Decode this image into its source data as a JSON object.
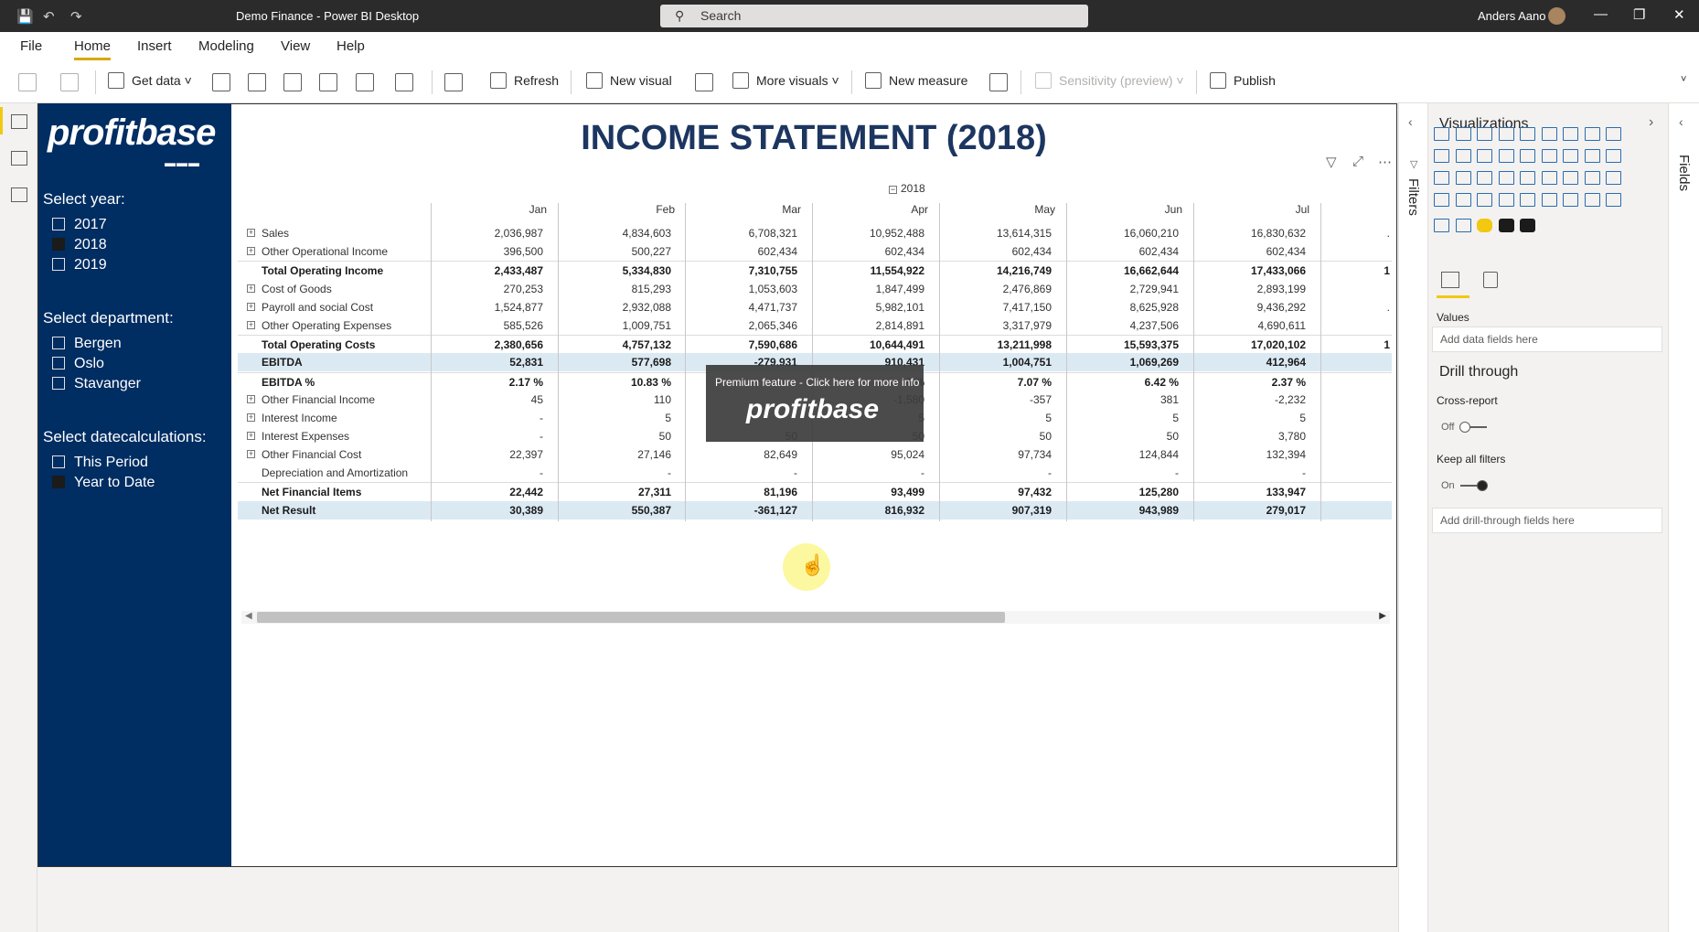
{
  "window": {
    "title": "Demo Finance - Power BI Desktop",
    "search_placeholder": "Search",
    "user": "Anders Aano"
  },
  "menu": {
    "items": [
      "File",
      "Home",
      "Insert",
      "Modeling",
      "View",
      "Help"
    ],
    "active": "Home"
  },
  "ribbon": {
    "get_data": "Get data",
    "refresh": "Refresh",
    "new_visual": "New visual",
    "more_visuals": "More visuals",
    "new_measure": "New measure",
    "sensitivity": "Sensitivity (preview)",
    "publish": "Publish"
  },
  "slicers": {
    "logo": "profitbase",
    "year": {
      "title": "Select year:",
      "options": [
        "2017",
        "2018",
        "2019"
      ],
      "selected": "2018"
    },
    "department": {
      "title": "Select department:",
      "options": [
        "Bergen",
        "Oslo",
        "Stavanger"
      ]
    },
    "datecalc": {
      "title": "Select datecalculations:",
      "options": [
        "This Period",
        "Year to Date"
      ],
      "selected": "Year to Date"
    }
  },
  "report": {
    "title": "INCOME STATEMENT (2018)",
    "year_header": "2018",
    "months": [
      "Jan",
      "Feb",
      "Mar",
      "Apr",
      "May",
      "Jun",
      "Jul"
    ],
    "rows": [
      {
        "label": "Sales",
        "expand": true,
        "values": [
          "2,036,987",
          "4,834,603",
          "6,708,321",
          "10,952,488",
          "13,614,315",
          "16,060,210",
          "16,830,632"
        ],
        "extra": "."
      },
      {
        "label": "Other Operational Income",
        "expand": true,
        "values": [
          "396,500",
          "500,227",
          "602,434",
          "602,434",
          "602,434",
          "602,434",
          "602,434"
        ],
        "extra": ""
      },
      {
        "label": "Total Operating Income",
        "bold": true,
        "values": [
          "2,433,487",
          "5,334,830",
          "7,310,755",
          "11,554,922",
          "14,216,749",
          "16,662,644",
          "17,433,066"
        ],
        "extra": "1"
      },
      {
        "label": "Cost of Goods",
        "expand": true,
        "values": [
          "270,253",
          "815,293",
          "1,053,603",
          "1,847,499",
          "2,476,869",
          "2,729,941",
          "2,893,199"
        ],
        "extra": ""
      },
      {
        "label": "Payroll and social Cost",
        "expand": true,
        "values": [
          "1,524,877",
          "2,932,088",
          "4,471,737",
          "5,982,101",
          "7,417,150",
          "8,625,928",
          "9,436,292"
        ],
        "extra": "."
      },
      {
        "label": "Other Operating Expenses",
        "expand": true,
        "values": [
          "585,526",
          "1,009,751",
          "2,065,346",
          "2,814,891",
          "3,317,979",
          "4,237,506",
          "4,690,611"
        ],
        "extra": ""
      },
      {
        "label": "Total Operating Costs",
        "bold": true,
        "values": [
          "2,380,656",
          "4,757,132",
          "7,590,686",
          "10,644,491",
          "13,211,998",
          "15,593,375",
          "17,020,102"
        ],
        "extra": "1"
      },
      {
        "label": "EBITDA",
        "bold": true,
        "highlight": true,
        "values": [
          "52,831",
          "577,698",
          "-279,931",
          "910,431",
          "1,004,751",
          "1,069,269",
          "412,964"
        ],
        "extra": ""
      },
      {
        "label": "EBITDA %",
        "bold": true,
        "values": [
          "2.17 %",
          "10.83 %",
          "",
          "8 %",
          "7.07 %",
          "6.42 %",
          "2.37 %"
        ],
        "extra": ""
      },
      {
        "label": "Other Financial Income",
        "expand": true,
        "values": [
          "45",
          "110",
          "",
          "-1,580",
          "-357",
          "381",
          "-2,232"
        ],
        "extra": ""
      },
      {
        "label": "Interest Income",
        "expand": true,
        "values": [
          "-",
          "5",
          "",
          "5",
          "5",
          "5",
          "5"
        ],
        "extra": ""
      },
      {
        "label": "Interest Expenses",
        "expand": true,
        "values": [
          "-",
          "50",
          "50",
          "50",
          "50",
          "50",
          "3,780"
        ],
        "extra": ""
      },
      {
        "label": "Other Financial Cost",
        "expand": true,
        "values": [
          "22,397",
          "27,146",
          "82,649",
          "95,024",
          "97,734",
          "124,844",
          "132,394"
        ],
        "extra": ""
      },
      {
        "label": "Depreciation and Amortization",
        "values": [
          "-",
          "-",
          "-",
          "-",
          "-",
          "-",
          "-"
        ],
        "extra": ""
      },
      {
        "label": "Net Financial Items",
        "bold": true,
        "values": [
          "22,442",
          "27,311",
          "81,196",
          "93,499",
          "97,432",
          "125,280",
          "133,947"
        ],
        "extra": ""
      },
      {
        "label": "Net Result",
        "bold": true,
        "highlight": true,
        "values": [
          "30,389",
          "550,387",
          "-361,127",
          "816,932",
          "907,319",
          "943,989",
          "279,017"
        ],
        "extra": ""
      }
    ]
  },
  "tooltip": {
    "text": "Premium feature - Click here for more info",
    "logo": "profitbase"
  },
  "panes": {
    "filters": "Filters",
    "visualizations": "Visualizations",
    "fields": "Fields",
    "values_label": "Values",
    "values_placeholder": "Add data fields here",
    "drill_through": "Drill through",
    "cross_report": "Cross-report",
    "cross_report_state": "Off",
    "keep_filters": "Keep all filters",
    "keep_filters_state": "On",
    "drill_placeholder": "Add drill-through fields here"
  },
  "colors": {
    "slicer_bg": "#002d62",
    "title": "#1c3660",
    "highlight_row": "#dbe9f3",
    "accent": "#f2c811"
  }
}
